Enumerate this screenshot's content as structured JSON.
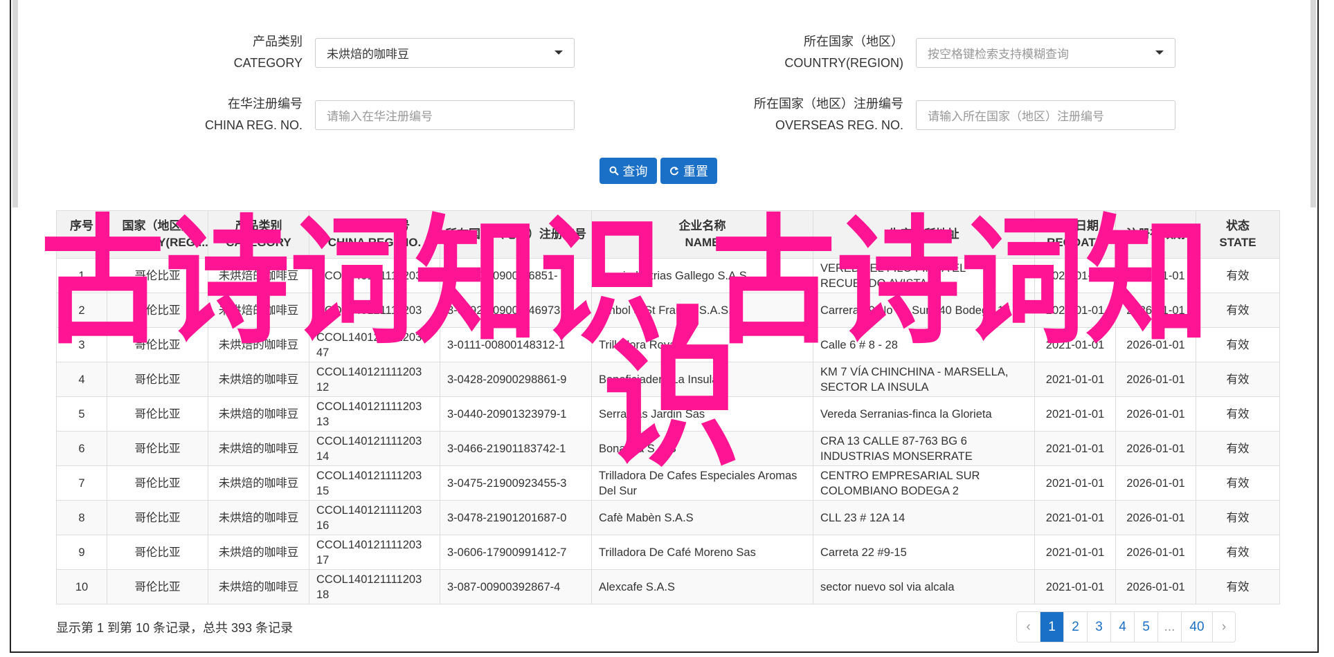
{
  "filters": {
    "category": {
      "label_cn": "产品类别",
      "label_en": "CATEGORY",
      "value": "未烘焙的咖啡豆"
    },
    "country": {
      "label_cn": "所在国家（地区）",
      "label_en": "COUNTRY(REGION)",
      "placeholder": "按空格键检索支持模糊查询"
    },
    "china_reg": {
      "label_cn": "在华注册编号",
      "label_en": "CHINA REG. NO.",
      "placeholder": "请输入在华注册编号"
    },
    "overseas_reg": {
      "label_cn": "所在国家（地区）注册编号",
      "label_en": "OVERSEAS REG. NO.",
      "placeholder": "请输入所在国家（地区）注册编号"
    }
  },
  "buttons": {
    "search": "查询",
    "reset": "重置"
  },
  "columns": [
    {
      "cn": "序号",
      "en": "NO."
    },
    {
      "cn": "国家（地区）",
      "en": "COUNTRY(REGI..."
    },
    {
      "cn": "产品类别",
      "en": "CATEGORY"
    },
    {
      "cn": "在华注册编号",
      "en": "CHINA REG. NO."
    },
    {
      "cn": "所在国家（地区）注册编号",
      "en": ""
    },
    {
      "cn": "企业名称",
      "en": "NAME"
    },
    {
      "cn": "生产场所地址",
      "en": ""
    },
    {
      "cn": "注册日期",
      "en": "REGDATE"
    },
    {
      "cn": "注册有效期",
      "en": ""
    },
    {
      "cn": "状态",
      "en": "STATE"
    }
  ],
  "rows": [
    {
      "no": "1",
      "country": "哥伦比亚",
      "category": "未烘焙的咖啡豆",
      "china_reg": "CCOL140121111203",
      "overseas_reg": "3-0200-00900-46851-",
      "name": "Agroindustrias Gallego S.A.S.",
      "address": "VEREDA EL FILO FINCA EL RECUERDO AVISTA",
      "regdate": "2021-01-01",
      "valid": "2026-01-01",
      "state": "有效"
    },
    {
      "no": "2",
      "country": "哥伦比亚",
      "category": "未烘焙的咖啡豆",
      "china_reg": "CCOL140121111203",
      "overseas_reg": "3-0392-00900-146973",
      "name": "Sinbol & St Francis S.A.S.",
      "address": "Carrera 49 No 61 Sur 540 Bodega 15",
      "regdate": "2021-01-01",
      "valid": "2026-01-01",
      "state": "有效"
    },
    {
      "no": "3",
      "country": "哥伦比亚",
      "category": "未烘焙的咖啡豆",
      "china_reg": "CCOL140121111203 47",
      "overseas_reg": "3-0111-00800148312-1",
      "name": "Trilladora Royal",
      "address": "Calle 6 # 8 - 28",
      "regdate": "2021-01-01",
      "valid": "2026-01-01",
      "state": "有效"
    },
    {
      "no": "4",
      "country": "哥伦比亚",
      "category": "未烘焙的咖啡豆",
      "china_reg": "CCOL140121111203 12",
      "overseas_reg": "3-0428-20900298861-9",
      "name": "Beneficiadero La Insula",
      "address": "KM 7 VÍA CHINCHINA - MARSELLA, SECTOR LA INSULA",
      "regdate": "2021-01-01",
      "valid": "2026-01-01",
      "state": "有效"
    },
    {
      "no": "5",
      "country": "哥伦比亚",
      "category": "未烘焙的咖啡豆",
      "china_reg": "CCOL140121111203 13",
      "overseas_reg": "3-0440-20901323979-1",
      "name": "Serranias Jardin Sas",
      "address": "Vereda Serranias-finca la Glorieta",
      "regdate": "2021-01-01",
      "valid": "2026-01-01",
      "state": "有效"
    },
    {
      "no": "6",
      "country": "哥伦比亚",
      "category": "未烘焙的咖啡豆",
      "china_reg": "CCOL140121111203 14",
      "overseas_reg": "3-0466-21901183742-1",
      "name": "Bonanza S.A.S",
      "address": "CRA 13 CALLE 87-763 BG 6 INDUSTRIAS MONSERRATE",
      "regdate": "2021-01-01",
      "valid": "2026-01-01",
      "state": "有效"
    },
    {
      "no": "7",
      "country": "哥伦比亚",
      "category": "未烘焙的咖啡豆",
      "china_reg": "CCOL140121111203 15",
      "overseas_reg": "3-0475-21900923455-3",
      "name": "Trilladora De Cafes Especiales Aromas Del Sur",
      "address": "CENTRO EMPRESARIAL SUR COLOMBIANO BODEGA 2",
      "regdate": "2021-01-01",
      "valid": "2026-01-01",
      "state": "有效"
    },
    {
      "no": "8",
      "country": "哥伦比亚",
      "category": "未烘焙的咖啡豆",
      "china_reg": "CCOL140121111203 16",
      "overseas_reg": "3-0478-21901201687-0",
      "name": "Cafè Mabèn S.A.S",
      "address": "CLL 23 # 12A 14",
      "regdate": "2021-01-01",
      "valid": "2026-01-01",
      "state": "有效"
    },
    {
      "no": "9",
      "country": "哥伦比亚",
      "category": "未烘焙的咖啡豆",
      "china_reg": "CCOL140121111203 17",
      "overseas_reg": "3-0606-17900991412-7",
      "name": "Trilladora De Café Moreno Sas",
      "address": "Carreta 22 #9-15",
      "regdate": "2021-01-01",
      "valid": "2026-01-01",
      "state": "有效"
    },
    {
      "no": "10",
      "country": "哥伦比亚",
      "category": "未烘焙的咖啡豆",
      "china_reg": "CCOL140121111203 18",
      "overseas_reg": "3-087-00900392867-4",
      "name": "Alexcafe S.A.S",
      "address": "sector nuevo sol via alcala",
      "regdate": "2021-01-01",
      "valid": "2026-01-01",
      "state": "有效"
    }
  ],
  "summary": "显示第 1 到第 10 条记录，总共 393 条记录",
  "pagination": {
    "prev": "‹",
    "pages": [
      "1",
      "2",
      "3",
      "4",
      "5",
      "...",
      "40"
    ],
    "next": "›",
    "active": "1"
  },
  "watermark": {
    "line1": "古诗词知识,古诗词知",
    "line2": "识",
    "color": "#ff1493"
  },
  "colors": {
    "primary": "#1a6fc6",
    "watermark": "#ff1493"
  }
}
